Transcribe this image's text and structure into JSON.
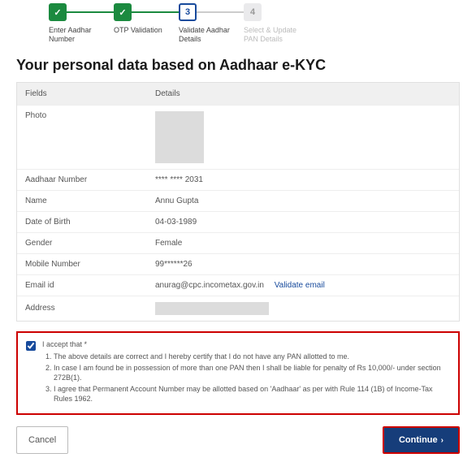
{
  "stepper": {
    "steps": [
      {
        "label": "Enter Aadhar\nNumber",
        "state": "done"
      },
      {
        "label": "OTP Validation",
        "state": "done"
      },
      {
        "num": "3",
        "label": "Validate Aadhar\nDetails",
        "state": "active"
      },
      {
        "num": "4",
        "label": "Select & Update\nPAN Details",
        "state": "inactive"
      }
    ]
  },
  "title": "Your personal data based on Aadhaar e-KYC",
  "table": {
    "head_field": "Fields",
    "head_detail": "Details",
    "rows": {
      "photo_label": "Photo",
      "aadhaar_label": "Aadhaar Number",
      "aadhaar_value": "**** **** 2031",
      "name_label": "Name",
      "name_value": "Annu Gupta",
      "dob_label": "Date of Birth",
      "dob_value": "04-03-1989",
      "gender_label": "Gender",
      "gender_value": "Female",
      "mobile_label": "Mobile Number",
      "mobile_value": "99******26",
      "email_label": "Email id",
      "email_value": "anurag@cpc.incometax.gov.in",
      "email_action": "Validate email",
      "address_label": "Address"
    }
  },
  "consent": {
    "lead": "I accept that *",
    "items": [
      "The above details are correct and I hereby certify that I do not have any PAN allotted to me.",
      "In case I am found be in possession of more than one PAN then I shall be liable for penalty of Rs 10,000/- under section 272B(1).",
      "I agree that Permanent Account Number may be allotted based on 'Aadhaar' as per with Rule 114 (1B) of Income-Tax Rules 1962."
    ],
    "checked": true
  },
  "actions": {
    "cancel": "Cancel",
    "continue": "Continue"
  }
}
